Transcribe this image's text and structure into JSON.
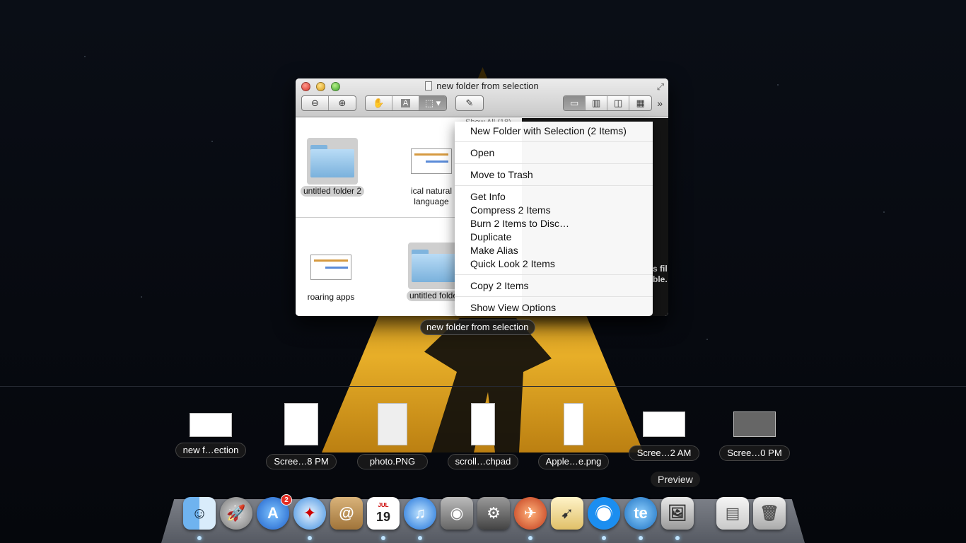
{
  "window": {
    "title": "new folder from selection"
  },
  "toolbar": {
    "zoom_out_icon": "zoom-out-icon",
    "zoom_in_icon": "zoom-in-icon",
    "hand_icon": "hand-icon",
    "text_icon": "text-select-icon",
    "select_icon": "rect-select-icon",
    "annotate_icon": "pencil-icon"
  },
  "content": {
    "show_all": "Show All (18)",
    "files": [
      {
        "label": "untitled folder 2",
        "kind": "folder",
        "selected": true
      },
      {
        "label": "ical natural\nlanguage",
        "kind": "doc",
        "selected": false
      },
      {
        "label": "roaring apps",
        "kind": "doc",
        "selected": false
      },
      {
        "label": "untitled folde",
        "kind": "folder",
        "selected": true
      }
    ],
    "right_partial": "s fil\nble."
  },
  "context_menu": {
    "groups": [
      [
        "New Folder with Selection (2 Items)"
      ],
      [
        "Open"
      ],
      [
        "Move to Trash"
      ],
      [
        "Get Info",
        "Compress 2 Items",
        "Burn 2 Items to Disc…",
        "Duplicate",
        "Make Alias",
        "Quick Look 2 Items"
      ],
      [
        "Copy 2 Items"
      ],
      [
        "Show View Options"
      ]
    ]
  },
  "stack_caption": "new folder from selection",
  "shelf": [
    "new f…ection",
    "Scree…8 PM",
    "photo.PNG",
    "scroll…chpad",
    "Apple…e.png",
    "Scree…2 AM",
    "Scree…0 PM"
  ],
  "dock": {
    "tooltip": "Preview",
    "appstore_badge": "2",
    "calendar_month": "JUL",
    "calendar_day": "19",
    "te_label": "te"
  },
  "colors": {
    "menu_bg": "#ffffff",
    "spotlight": "#f3b72a",
    "badge": "#e32c23"
  }
}
